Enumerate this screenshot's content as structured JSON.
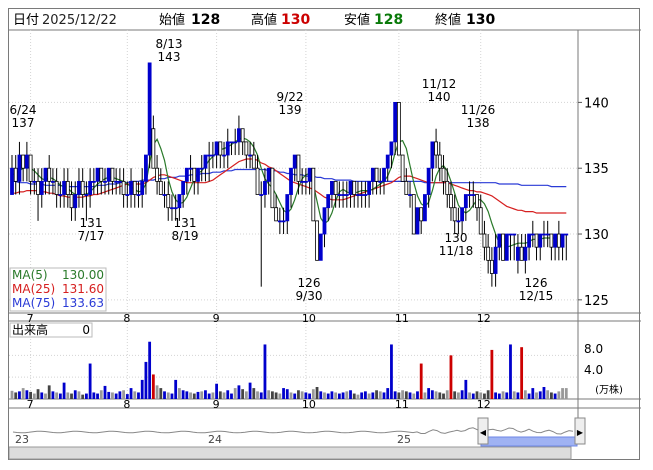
{
  "header": {
    "date_label": "日付",
    "date": "2025/12/22",
    "open_label": "始値",
    "open": "128",
    "high_label": "高値",
    "high": "130",
    "low_label": "安値",
    "low": "128",
    "close_label": "終値",
    "close": "130"
  },
  "colors": {
    "up": "#0000cc",
    "down": "#000000",
    "vol_up": "#0000cc",
    "vol_down": "#444444",
    "vol_today": "#999999",
    "vol_hi": "#cc0000",
    "ma5": "#2a7a2a",
    "ma25": "#d62020",
    "ma75": "#2a3ad6",
    "navigator": "#6d86e6"
  },
  "legend": {
    "ma5_label": "MA(5)",
    "ma5_value": "130.00",
    "ma25_label": "MA(25)",
    "ma25_value": "131.60",
    "ma75_label": "MA(75)",
    "ma75_value": "133.63"
  },
  "volume_panel": {
    "title": "出来高",
    "current": "0",
    "unit": "(万株)",
    "ticks": [
      "8.0",
      "4.0"
    ]
  },
  "navigator_labels": [
    "23",
    "24",
    "25"
  ],
  "annotations": [
    {
      "date": "6/24",
      "value": "137"
    },
    {
      "date": "7/17",
      "value": "131"
    },
    {
      "date": "8/13",
      "value": "143"
    },
    {
      "date": "8/19",
      "value": "131"
    },
    {
      "date": "9/22",
      "value": "139"
    },
    {
      "date": "9/30",
      "value": "126"
    },
    {
      "date": "11/12",
      "value": "140"
    },
    {
      "date": "11/18",
      "value": "130"
    },
    {
      "date": "11/26",
      "value": "138"
    },
    {
      "date": "12/15",
      "value": "126"
    }
  ],
  "chart_data": {
    "type": "candlestick",
    "y_ticks": [
      125,
      130,
      135,
      140
    ],
    "ylim": [
      124,
      145.5
    ],
    "x_ticks": [
      "7",
      "8",
      "9",
      "10",
      "11",
      "12"
    ],
    "x_tick_index": [
      5,
      31,
      55,
      79,
      104,
      126
    ],
    "n_days": 150,
    "candles": [
      [
        133,
        136,
        133,
        135
      ],
      [
        135,
        136,
        133,
        134
      ],
      [
        134,
        137,
        133,
        136
      ],
      [
        136,
        136,
        134,
        135
      ],
      [
        135,
        137,
        134,
        136
      ],
      [
        136,
        136,
        133,
        134
      ],
      [
        134,
        135,
        133,
        134
      ],
      [
        134,
        135,
        131,
        133
      ],
      [
        133,
        135,
        132,
        134
      ],
      [
        134,
        135,
        133,
        135
      ],
      [
        135,
        136,
        133,
        134
      ],
      [
        134,
        135,
        133,
        134
      ],
      [
        134,
        135,
        132,
        133
      ],
      [
        133,
        134,
        132,
        133
      ],
      [
        133,
        135,
        132,
        134
      ],
      [
        134,
        135,
        132,
        133
      ],
      [
        133,
        134,
        131,
        132
      ],
      [
        132,
        134,
        131,
        133
      ],
      [
        133,
        135,
        132,
        134
      ],
      [
        134,
        135,
        132,
        133
      ],
      [
        133,
        134,
        131,
        133
      ],
      [
        133,
        135,
        132,
        134
      ],
      [
        134,
        135,
        133,
        134
      ],
      [
        134,
        135,
        133,
        135
      ],
      [
        135,
        135,
        133,
        134
      ],
      [
        134,
        135,
        133,
        134
      ],
      [
        134,
        135,
        133,
        135
      ],
      [
        135,
        135,
        133,
        134
      ],
      [
        134,
        135,
        133,
        134
      ],
      [
        134,
        135,
        133,
        134
      ],
      [
        134,
        135,
        132,
        133
      ],
      [
        133,
        134,
        132,
        133
      ],
      [
        133,
        135,
        132,
        134
      ],
      [
        134,
        134,
        132,
        133
      ],
      [
        133,
        134,
        132,
        133
      ],
      [
        133,
        135,
        132,
        134
      ],
      [
        134,
        136,
        133,
        136
      ],
      [
        136,
        143,
        135,
        143
      ],
      [
        138,
        139,
        135,
        135
      ],
      [
        135,
        136,
        133,
        134
      ],
      [
        134,
        135,
        133,
        133
      ],
      [
        133,
        134,
        132,
        133
      ],
      [
        133,
        134,
        131,
        132
      ],
      [
        132,
        133,
        131,
        132
      ],
      [
        132,
        133,
        131,
        132
      ],
      [
        132,
        133,
        131,
        133
      ],
      [
        133,
        134,
        132,
        134
      ],
      [
        134,
        135,
        133,
        135
      ],
      [
        135,
        136,
        134,
        135
      ],
      [
        135,
        135,
        133,
        134
      ],
      [
        134,
        135,
        133,
        135
      ],
      [
        135,
        136,
        134,
        135
      ],
      [
        135,
        136,
        134,
        136
      ],
      [
        136,
        137,
        134,
        136
      ],
      [
        136,
        137,
        135,
        136
      ],
      [
        136,
        137,
        135,
        137
      ],
      [
        137,
        137,
        135,
        136
      ],
      [
        136,
        137,
        135,
        136
      ],
      [
        136,
        138,
        135,
        137
      ],
      [
        137,
        137,
        136,
        137
      ],
      [
        137,
        138,
        136,
        137
      ],
      [
        137,
        139,
        136,
        138
      ],
      [
        138,
        138,
        136,
        137
      ],
      [
        137,
        137,
        135,
        136
      ],
      [
        136,
        137,
        135,
        136
      ],
      [
        136,
        137,
        135,
        135
      ],
      [
        135,
        136,
        133,
        133
      ],
      [
        133,
        134,
        126,
        133
      ],
      [
        133,
        135,
        132,
        134
      ],
      [
        134,
        135,
        133,
        135
      ],
      [
        135,
        135,
        132,
        132
      ],
      [
        132,
        133,
        131,
        131
      ],
      [
        131,
        132,
        130,
        131
      ],
      [
        131,
        132,
        130,
        131
      ],
      [
        131,
        133,
        130,
        133
      ],
      [
        133,
        135,
        132,
        135
      ],
      [
        135,
        136,
        134,
        136
      ],
      [
        136,
        136,
        133,
        134
      ],
      [
        134,
        135,
        133,
        134
      ],
      [
        134,
        135,
        133,
        134
      ],
      [
        134,
        135,
        133,
        135
      ],
      [
        135,
        135,
        131,
        131
      ],
      [
        131,
        131,
        128,
        128
      ],
      [
        128,
        130,
        128,
        130
      ],
      [
        130,
        132,
        129,
        132
      ],
      [
        132,
        133,
        131,
        133
      ],
      [
        133,
        134,
        132,
        134
      ],
      [
        134,
        134,
        132,
        133
      ],
      [
        133,
        134,
        132,
        133
      ],
      [
        133,
        134,
        132,
        133
      ],
      [
        133,
        134,
        132,
        133
      ],
      [
        133,
        134,
        132,
        134
      ],
      [
        134,
        134,
        132,
        133
      ],
      [
        133,
        134,
        132,
        133
      ],
      [
        133,
        134,
        132,
        133
      ],
      [
        133,
        134,
        132,
        133
      ],
      [
        133,
        134,
        132,
        134
      ],
      [
        134,
        135,
        133,
        135
      ],
      [
        135,
        135,
        133,
        134
      ],
      [
        134,
        135,
        133,
        134
      ],
      [
        134,
        135,
        133,
        135
      ],
      [
        135,
        136,
        134,
        136
      ],
      [
        136,
        137,
        135,
        137
      ],
      [
        137,
        140,
        136,
        140
      ],
      [
        140,
        140,
        136,
        136
      ],
      [
        136,
        136,
        134,
        134
      ],
      [
        134,
        135,
        133,
        133
      ],
      [
        133,
        134,
        132,
        133
      ],
      [
        133,
        133,
        130,
        130
      ],
      [
        130,
        132,
        130,
        132
      ],
      [
        132,
        132,
        130,
        131
      ],
      [
        131,
        133,
        131,
        133
      ],
      [
        133,
        135,
        132,
        135
      ],
      [
        135,
        137,
        134,
        137
      ],
      [
        137,
        138,
        135,
        136
      ],
      [
        136,
        137,
        134,
        135
      ],
      [
        135,
        136,
        133,
        134
      ],
      [
        134,
        135,
        132,
        133
      ],
      [
        133,
        134,
        131,
        132
      ],
      [
        132,
        133,
        130,
        131
      ],
      [
        131,
        132,
        130,
        131
      ],
      [
        131,
        132,
        130,
        132
      ],
      [
        132,
        133,
        131,
        133
      ],
      [
        133,
        134,
        132,
        133
      ],
      [
        133,
        134,
        132,
        133
      ],
      [
        133,
        133,
        131,
        132
      ],
      [
        132,
        133,
        130,
        130
      ],
      [
        130,
        131,
        128,
        129
      ],
      [
        129,
        130,
        127,
        128
      ],
      [
        128,
        129,
        126,
        127
      ],
      [
        127,
        130,
        126,
        129
      ],
      [
        129,
        130,
        128,
        130
      ],
      [
        130,
        130,
        128,
        128
      ],
      [
        128,
        130,
        128,
        130
      ],
      [
        130,
        130,
        128,
        130
      ],
      [
        130,
        130,
        128,
        130
      ],
      [
        128,
        130,
        127,
        129
      ],
      [
        129,
        130,
        128,
        128
      ],
      [
        128,
        130,
        127,
        129
      ],
      [
        129,
        130,
        128,
        130
      ],
      [
        130,
        131,
        129,
        130
      ],
      [
        130,
        130,
        128,
        129
      ],
      [
        129,
        130,
        128,
        130
      ],
      [
        130,
        131,
        129,
        130
      ],
      [
        130,
        131,
        129,
        130
      ],
      [
        130,
        130,
        128,
        129
      ],
      [
        129,
        130,
        128,
        130
      ],
      [
        130,
        131,
        128,
        129
      ],
      [
        129,
        130,
        128,
        130
      ],
      [
        130,
        130,
        128,
        130
      ]
    ],
    "ma5": [
      134.5,
      134.6,
      134.8,
      135,
      135.1,
      135,
      134.8,
      134.5,
      134.2,
      134.1,
      134.3,
      134.2,
      134,
      133.7,
      133.6,
      133.5,
      133.2,
      133,
      133,
      133.1,
      133,
      133.2,
      133.5,
      133.8,
      134,
      134.2,
      134.3,
      134.3,
      134.2,
      134.1,
      134,
      133.8,
      133.6,
      133.4,
      133.2,
      133.3,
      133.8,
      135.4,
      136.8,
      137.2,
      136.5,
      135.6,
      134.2,
      133.2,
      132.6,
      132.3,
      132.4,
      132.8,
      133.5,
      134.2,
      134.6,
      134.8,
      135.2,
      135.6,
      135.9,
      136.2,
      136.4,
      136.5,
      136.6,
      136.8,
      137,
      137.2,
      137.3,
      137.2,
      137,
      136.6,
      136,
      135,
      134.2,
      133.8,
      133.5,
      133,
      132.4,
      131.8,
      131.6,
      131.9,
      132.6,
      133.5,
      134.2,
      134.5,
      134.6,
      133.8,
      132.5,
      131.2,
      130.8,
      131,
      131.6,
      132.5,
      133.2,
      133.4,
      133.2,
      133.1,
      133.1,
      133.2,
      133.3,
      133.3,
      133.3,
      133.4,
      133.6,
      133.8,
      134,
      134.4,
      135.1,
      136.2,
      137,
      137.1,
      136.5,
      135.2,
      133.9,
      132.9,
      132.3,
      132.1,
      132.4,
      133.3,
      134.4,
      135,
      135.2,
      134.8,
      134,
      133.1,
      132.2,
      131.8,
      131.6,
      131.8,
      132.2,
      132.6,
      132.6,
      132.3,
      131.7,
      130.8,
      130,
      129.3,
      129,
      129,
      129.1,
      129.2,
      129.3,
      129.3,
      129.3,
      129.4,
      129.6,
      129.6,
      129.6,
      129.7,
      129.7,
      129.7,
      129.7,
      129.8
    ],
    "ma25": [
      133.1,
      133.1,
      133.2,
      133.2,
      133.3,
      133.3,
      133.3,
      133.3,
      133.2,
      133.2,
      133.1,
      133.1,
      133,
      132.9,
      132.9,
      132.8,
      132.8,
      132.8,
      132.8,
      132.8,
      132.9,
      132.9,
      133,
      133,
      133.1,
      133.2,
      133.3,
      133.4,
      133.5,
      133.6,
      133.7,
      133.8,
      133.8,
      133.8,
      133.8,
      133.8,
      133.9,
      134.1,
      134.3,
      134.4,
      134.5,
      134.5,
      134.4,
      134.3,
      134.2,
      134.1,
      134,
      133.9,
      133.9,
      133.9,
      133.9,
      133.9,
      133.9,
      134,
      134.1,
      134.3,
      134.5,
      134.7,
      134.9,
      135.1,
      135.3,
      135.5,
      135.6,
      135.7,
      135.7,
      135.7,
      135.6,
      135.4,
      135.3,
      135.1,
      135,
      134.8,
      134.6,
      134.4,
      134.2,
      134,
      133.9,
      133.8,
      133.7,
      133.6,
      133.5,
      133.4,
      133.2,
      133,
      132.8,
      132.7,
      132.6,
      132.6,
      132.6,
      132.6,
      132.7,
      132.8,
      132.9,
      133,
      133.1,
      133.2,
      133.3,
      133.4,
      133.5,
      133.6,
      133.7,
      133.8,
      133.9,
      134.1,
      134.3,
      134.4,
      134.4,
      134.4,
      134.3,
      134.2,
      134.1,
      134,
      133.9,
      133.9,
      133.9,
      133.9,
      133.9,
      133.9,
      133.8,
      133.7,
      133.6,
      133.5,
      133.4,
      133.3,
      133.3,
      133.2,
      133.2,
      133.1,
      133,
      132.9,
      132.7,
      132.5,
      132.3,
      132.1,
      132,
      131.9,
      131.8,
      131.8,
      131.7,
      131.7,
      131.7,
      131.6,
      131.6,
      131.6,
      131.6,
      131.6,
      131.6,
      131.6,
      131.6,
      131.6
    ],
    "ma75": [
      134.0,
      134.0,
      133.9,
      133.9,
      133.9,
      133.8,
      133.8,
      133.8,
      133.8,
      133.7,
      133.7,
      133.7,
      133.7,
      133.7,
      133.6,
      133.6,
      133.6,
      133.6,
      133.6,
      133.6,
      133.6,
      133.6,
      133.6,
      133.7,
      133.7,
      133.7,
      133.8,
      133.8,
      133.8,
      133.9,
      133.9,
      133.9,
      134,
      134,
      134,
      134.1,
      134.1,
      134.1,
      134.1,
      134.2,
      134.2,
      134.2,
      134.3,
      134.3,
      134.3,
      134.4,
      134.4,
      134.4,
      134.5,
      134.5,
      134.5,
      134.6,
      134.6,
      134.6,
      134.7,
      134.7,
      134.7,
      134.8,
      134.8,
      134.8,
      134.9,
      134.9,
      134.9,
      134.9,
      134.9,
      134.9,
      134.9,
      134.9,
      134.9,
      134.8,
      134.8,
      134.8,
      134.7,
      134.7,
      134.6,
      134.6,
      134.5,
      134.5,
      134.5,
      134.4,
      134.4,
      134.4,
      134.3,
      134.3,
      134.2,
      134.2,
      134.2,
      134.1,
      134.1,
      134.1,
      134.1,
      134.1,
      134,
      134,
      134,
      134,
      134,
      134,
      134,
      134,
      134,
      134,
      134,
      134,
      134,
      134,
      134,
      134,
      134,
      134,
      134,
      133.9,
      133.9,
      133.9,
      133.9,
      133.9,
      133.9,
      133.9,
      133.9,
      133.9,
      133.9,
      133.9,
      133.9,
      133.9,
      133.9,
      133.9,
      133.9,
      133.9,
      133.9,
      133.9,
      133.9,
      133.8,
      133.8,
      133.8,
      133.8,
      133.8,
      133.8,
      133.7,
      133.7,
      133.7,
      133.7,
      133.7,
      133.7,
      133.7,
      133.7,
      133.6,
      133.6,
      133.6,
      133.6,
      133.6
    ],
    "volume": [
      1.5,
      1.2,
      1.4,
      2.0,
      1.6,
      1.3,
      1.0,
      1.8,
      1.2,
      1.0,
      2.5,
      1.4,
      1.2,
      1.0,
      3.0,
      1.2,
      1.0,
      1.6,
      1.4,
      0.8,
      1.0,
      6.5,
      1.2,
      1.0,
      1.6,
      2.4,
      1.3,
      1.2,
      1.0,
      1.4,
      1.6,
      0.9,
      2.0,
      1.4,
      1.2,
      3.5,
      6.8,
      10.5,
      4.5,
      2.5,
      2.0,
      1.4,
      1.2,
      1.0,
      3.5,
      2.0,
      1.6,
      1.4,
      1.2,
      1.0,
      1.3,
      1.4,
      1.6,
      1.0,
      1.2,
      2.8,
      1.4,
      1.2,
      1.6,
      1.0,
      2.0,
      2.5,
      1.8,
      1.4,
      3.0,
      2.0,
      1.4,
      1.2,
      10.0,
      1.6,
      1.4,
      1.2,
      1.0,
      2.0,
      1.8,
      1.2,
      1.0,
      1.6,
      1.4,
      1.2,
      1.0,
      1.8,
      2.2,
      1.4,
      1.2,
      1.0,
      1.4,
      1.2,
      1.0,
      1.2,
      1.4,
      1.6,
      1.0,
      0.8,
      1.2,
      1.4,
      1.0,
      1.2,
      1.6,
      1.4,
      1.2,
      2.0,
      10.0,
      1.4,
      1.2,
      1.6,
      1.4,
      1.2,
      1.0,
      1.4,
      6.5,
      1.2,
      2.0,
      1.6,
      1.4,
      1.2,
      1.0,
      1.6,
      8.0,
      1.4,
      1.2,
      1.6,
      3.5,
      1.2,
      1.0,
      1.4,
      1.2,
      1.0,
      1.6,
      9.0,
      1.2,
      1.0,
      1.4,
      1.2,
      10.0,
      1.4,
      1.2,
      9.5,
      1.6,
      1.0,
      2.0,
      1.2,
      1.4,
      2.2,
      1.6,
      1.2,
      1.0,
      1.4,
      2.0,
      2.0
    ]
  }
}
